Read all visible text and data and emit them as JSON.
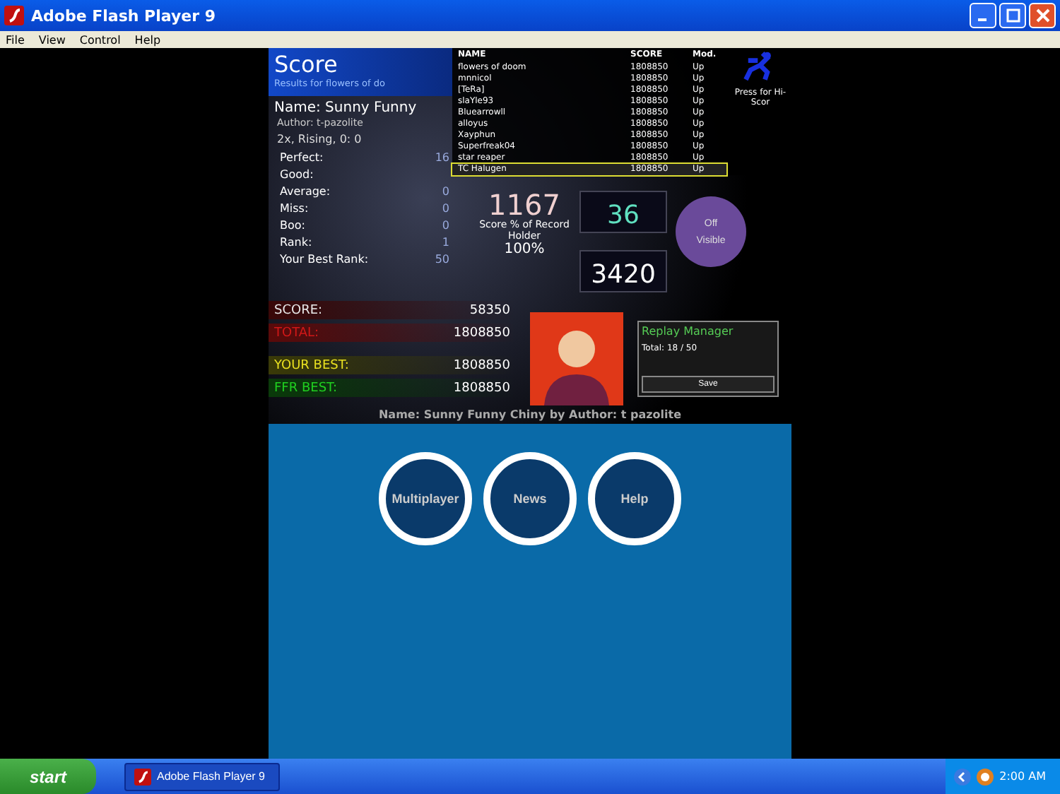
{
  "window": {
    "title": "Adobe Flash Player 9"
  },
  "menu": [
    "File",
    "View",
    "Control",
    "Help"
  ],
  "score_header": {
    "title": "Score",
    "subtitle": "Results for flowers of do"
  },
  "song": {
    "name": "Name: Sunny Funny",
    "author": "Author: t-pazolite",
    "mode": "2x, Rising, 0: 0"
  },
  "stats": [
    {
      "label": "Perfect:",
      "value": "16"
    },
    {
      "label": "Good:"
    },
    {
      "label": "Average:",
      "value": "0"
    },
    {
      "label": "Miss:",
      "value": "0"
    },
    {
      "label": "Boo:",
      "value": "0"
    },
    {
      "label": "Rank:",
      "value": "1"
    },
    {
      "label": "Your Best Rank:",
      "value": "50"
    }
  ],
  "leaderboard": {
    "columns": [
      "NAME",
      "SCORE",
      "Mod."
    ],
    "rows": [
      {
        "name": "flowers of doom",
        "score": "1808850",
        "mod": "Up",
        "selected": false
      },
      {
        "name": "mnnicol",
        "score": "1808850",
        "mod": "Up",
        "selected": false
      },
      {
        "name": "[TeRa]",
        "score": "1808850",
        "mod": "Up",
        "selected": false
      },
      {
        "name": "slaYle93",
        "score": "1808850",
        "mod": "Up",
        "selected": false
      },
      {
        "name": "Bluearrowll",
        "score": "1808850",
        "mod": "Up",
        "selected": false
      },
      {
        "name": "alloyus",
        "score": "1808850",
        "mod": "Up",
        "selected": false
      },
      {
        "name": "Xayphun",
        "score": "1808850",
        "mod": "Up",
        "selected": false
      },
      {
        "name": "Superfreak04",
        "score": "1808850",
        "mod": "Up",
        "selected": false
      },
      {
        "name": "star reaper",
        "score": "1808850",
        "mod": "Up",
        "selected": false
      },
      {
        "name": "TC Halugen",
        "score": "1808850",
        "mod": "Up",
        "selected": true
      }
    ],
    "hint": "Press for Hi-Scor"
  },
  "record": {
    "value": "1167",
    "label": "Score % of Record Holder",
    "percent": "100%"
  },
  "combo": "36",
  "arrows": "3420",
  "visibility": [
    "Off",
    "Visible"
  ],
  "scores": [
    {
      "kind": "score",
      "label": "SCORE:",
      "value": "58350"
    },
    {
      "kind": "total",
      "label": "TOTAL:",
      "value": "1808850"
    },
    {
      "kind": "best",
      "label": "YOUR BEST:",
      "value": "1808850"
    },
    {
      "kind": "ffr",
      "label": "FFR BEST:",
      "value": "1808850"
    }
  ],
  "replay": {
    "title": "Replay Manager",
    "total": "Total: 18 / 50",
    "button": "Save"
  },
  "caption": "Name: Sunny Funny Chiny by Author: t pazolite",
  "nav_buttons": [
    {
      "label": "Multiplayer"
    },
    {
      "label": "News"
    },
    {
      "label": "Help"
    }
  ],
  "taskbar": {
    "start": "start",
    "task": "Adobe Flash Player 9",
    "time": "2:00 AM"
  }
}
